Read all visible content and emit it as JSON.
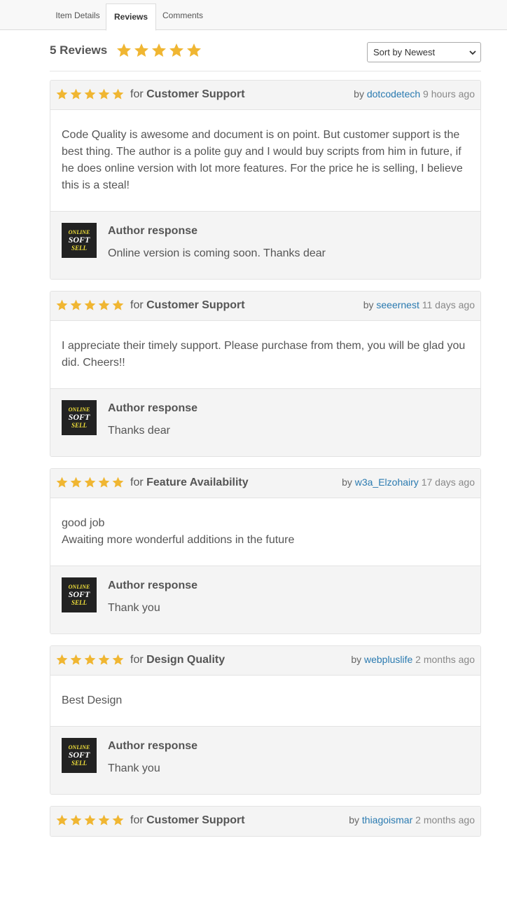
{
  "tabs": [
    {
      "label": "Item Details"
    },
    {
      "label": "Reviews"
    },
    {
      "label": "Comments"
    }
  ],
  "summary": {
    "count_label": "5 Reviews",
    "rating": 5,
    "sort_selected": "Sort by Newest"
  },
  "colors": {
    "star": "#f0b632",
    "link": "#2a7ab0"
  },
  "logo": {
    "line1": "ONLINE",
    "line2": "SOFT",
    "line3": "SELL"
  },
  "reviews": [
    {
      "stars": 5,
      "for_label": "for",
      "category": "Customer Support",
      "by_label": "by",
      "author": "dotcodetech",
      "time": "9 hours ago",
      "body": "Code Quality is awesome and document is on point. But customer support is the best thing. The author is a polite guy and I would buy scripts from him in future, if he does online version with lot more features. For the price he is selling, I believe this is a steal!",
      "response_title": "Author response",
      "response_text": "Online version is coming soon. Thanks dear"
    },
    {
      "stars": 5,
      "for_label": "for",
      "category": "Customer Support",
      "by_label": "by",
      "author": "seeernest",
      "time": "11 days ago",
      "body": "I appreciate their timely support. Please purchase from them, you will be glad you did. Cheers!!",
      "response_title": "Author response",
      "response_text": "Thanks dear"
    },
    {
      "stars": 5,
      "for_label": "for",
      "category": "Feature Availability",
      "by_label": "by",
      "author": "w3a_Elzohairy",
      "time": "17 days ago",
      "body": "good job\nAwaiting more wonderful additions in the future",
      "response_title": "Author response",
      "response_text": "Thank you"
    },
    {
      "stars": 5,
      "for_label": "for",
      "category": "Design Quality",
      "by_label": "by",
      "author": "webpluslife",
      "time": "2 months ago",
      "body": "Best Design",
      "response_title": "Author response",
      "response_text": "Thank you"
    },
    {
      "stars": 5,
      "for_label": "for",
      "category": "Customer Support",
      "by_label": "by",
      "author": "thiagoismar",
      "time": "2 months ago"
    }
  ]
}
